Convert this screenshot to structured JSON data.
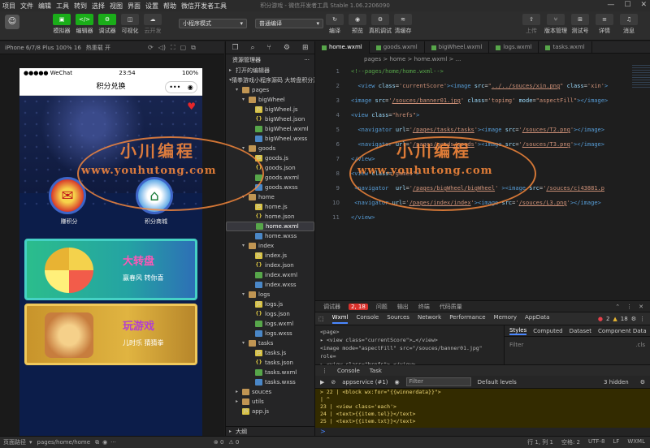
{
  "menubar": {
    "items": [
      "项目",
      "文件",
      "编辑",
      "工具",
      "转到",
      "选择",
      "视图",
      "界面",
      "设置",
      "帮助",
      "微信开发者工具"
    ],
    "title": "积分游戏 - 微信开发者工具 Stable 1.06.2206090"
  },
  "toolbar": {
    "left_buttons": [
      {
        "label": "模拟器",
        "glyph": "▣"
      },
      {
        "label": "编辑器",
        "glyph": "</>"
      },
      {
        "label": "调试器",
        "glyph": "⚙"
      },
      {
        "label": "可视化",
        "glyph": "◫"
      },
      {
        "label": "云开发",
        "glyph": "☁"
      }
    ],
    "mode_select": "小程序模式",
    "compile_select": "普通编译",
    "mid_buttons": [
      {
        "label": "编译",
        "glyph": "↻"
      },
      {
        "label": "预览",
        "glyph": "◉"
      },
      {
        "label": "真机调试",
        "glyph": "⚙"
      },
      {
        "label": "清缓存",
        "glyph": "≋"
      }
    ],
    "right_buttons": [
      {
        "label": "上传",
        "glyph": "⇧"
      },
      {
        "label": "版本管理",
        "glyph": "⑂"
      },
      {
        "label": "测试号",
        "glyph": "⊞"
      },
      {
        "label": "详情",
        "glyph": "≡"
      },
      {
        "label": "消息",
        "glyph": "♫"
      }
    ]
  },
  "simulator": {
    "device": "iPhone 6/7/8 Plus 100% 16",
    "hot_reload": "热重载 开",
    "status": {
      "carrier": "●●●●● WeChat",
      "time": "23:54",
      "battery": "100%"
    },
    "nav_title": "积分兑换",
    "icons": [
      {
        "label": "赚积分"
      },
      {
        "label": "积分商城"
      }
    ],
    "cards": [
      {
        "title": "大转盘",
        "subtitle": "赢春风  转你喜"
      },
      {
        "title": "玩游戏",
        "subtitle": "儿时乐  猜猜拳"
      }
    ]
  },
  "explorer": {
    "title": "资源管理器",
    "sections": {
      "open_editors": "打开的编辑器",
      "project": "猜拳游戏小程序源码 大转盘积分游..."
    },
    "tree": [
      {
        "name": "pages",
        "type": "folder",
        "depth": 1,
        "open": true
      },
      {
        "name": "bigWheel",
        "type": "folder",
        "depth": 2,
        "open": true
      },
      {
        "name": "bigWheel.js",
        "type": "js",
        "depth": 3
      },
      {
        "name": "bigWheel.json",
        "type": "json",
        "depth": 3
      },
      {
        "name": "bigWheel.wxml",
        "type": "wxml",
        "depth": 3
      },
      {
        "name": "bigWheel.wxss",
        "type": "wxss",
        "depth": 3
      },
      {
        "name": "goods",
        "type": "folder",
        "depth": 2,
        "open": true
      },
      {
        "name": "goods.js",
        "type": "js",
        "depth": 3
      },
      {
        "name": "goods.json",
        "type": "json",
        "depth": 3
      },
      {
        "name": "goods.wxml",
        "type": "wxml",
        "depth": 3
      },
      {
        "name": "goods.wxss",
        "type": "wxss",
        "depth": 3
      },
      {
        "name": "home",
        "type": "folder",
        "depth": 2,
        "open": true
      },
      {
        "name": "home.js",
        "type": "js",
        "depth": 3
      },
      {
        "name": "home.json",
        "type": "json",
        "depth": 3
      },
      {
        "name": "home.wxml",
        "type": "wxml",
        "depth": 3,
        "selected": true
      },
      {
        "name": "home.wxss",
        "type": "wxss",
        "depth": 3
      },
      {
        "name": "index",
        "type": "folder",
        "depth": 2,
        "open": true
      },
      {
        "name": "index.js",
        "type": "js",
        "depth": 3
      },
      {
        "name": "index.json",
        "type": "json",
        "depth": 3
      },
      {
        "name": "index.wxml",
        "type": "wxml",
        "depth": 3
      },
      {
        "name": "index.wxss",
        "type": "wxss",
        "depth": 3
      },
      {
        "name": "logs",
        "type": "folder",
        "depth": 2,
        "open": true
      },
      {
        "name": "logs.js",
        "type": "js",
        "depth": 3
      },
      {
        "name": "logs.json",
        "type": "json",
        "depth": 3
      },
      {
        "name": "logs.wxml",
        "type": "wxml",
        "depth": 3
      },
      {
        "name": "logs.wxss",
        "type": "wxss",
        "depth": 3
      },
      {
        "name": "tasks",
        "type": "folder",
        "depth": 2,
        "open": true
      },
      {
        "name": "tasks.js",
        "type": "js",
        "depth": 3
      },
      {
        "name": "tasks.json",
        "type": "json",
        "depth": 3
      },
      {
        "name": "tasks.wxml",
        "type": "wxml",
        "depth": 3
      },
      {
        "name": "tasks.wxss",
        "type": "wxss",
        "depth": 3
      },
      {
        "name": "souces",
        "type": "folder",
        "depth": 1,
        "open": false
      },
      {
        "name": "utils",
        "type": "folder",
        "depth": 1,
        "open": false
      },
      {
        "name": "app.js",
        "type": "js",
        "depth": 1
      }
    ],
    "outline": "大纲"
  },
  "editor": {
    "tabs": [
      "home.wxml",
      "goods.wxml",
      "bigWheel.wxml",
      "logs.wxml",
      "tasks.wxml"
    ],
    "breadcrumb": "pages > home > home.wxml > ...",
    "lines": [
      {
        "n": "1",
        "html": "<span class=\"cm\">&lt;!--pages/home/home.wxml--&gt;</span>"
      },
      {
        "n": "2",
        "html": "  <span class=\"tg\">&lt;view</span> <span class=\"at\">class</span>=<span class=\"st\">'currentScore'</span><span class=\"tg\">&gt;&lt;image</span> <span class=\"at\">src</span>=<span class=\"st\">\"<u>../../souces/xin.png</u>\"</span> <span class=\"at\">class</span>=<span class=\"st\">'xin'</span><span class=\"tg\">&gt;</span>"
      },
      {
        "n": "3",
        "html": "<span class=\"tg\">&lt;image</span> <span class=\"at\">src</span>=<span class=\"st\">'<u>/souces/banner01.jpg</u>'</span> <span class=\"at\">class</span>=<span class=\"st\">'topimg'</span> <span class=\"at\">mode</span>=<span class=\"st\">\"aspectFill\"</span><span class=\"tg\">&gt;&lt;/image&gt;</span>"
      },
      {
        "n": "4",
        "html": "<span class=\"tg\">&lt;view</span> <span class=\"at\">class</span>=<span class=\"st\">\"hrefs\"</span><span class=\"tg\">&gt;</span>"
      },
      {
        "n": "5",
        "html": "  <span class=\"tg\">&lt;navigator</span> <span class=\"at\">url</span>=<span class=\"st\">'<u>/pages/tasks/tasks</u>'</span><span class=\"tg\">&gt;&lt;image</span> <span class=\"at\">src</span>=<span class=\"st\">'<u>/souces/T2.png</u>'</span><span class=\"tg\">&gt;&lt;/image&gt;</span>"
      },
      {
        "n": "6",
        "html": "  <span class=\"tg\">&lt;navigator</span> <span class=\"at\">url</span>=<span class=\"st\">'<u>/pages/goods/goods</u>'</span><span class=\"tg\">&gt;&lt;image</span> <span class=\"at\">src</span>=<span class=\"st\">'<u>/souces/T3.png</u>'</span><span class=\"tg\">&gt;&lt;/image&gt;</span>"
      },
      {
        "n": "7",
        "html": "<span class=\"tg\">&lt;/view&gt;</span>"
      },
      {
        "n": "8",
        "html": "<span class=\"tg\">&lt;view</span> <span class=\"at\">class</span>=<span class=\"st\">\"games\"</span><span class=\"tg\">&gt;</span>"
      },
      {
        "n": "9",
        "html": " <span class=\"tg\">&lt;navigator</span>  <span class=\"at\">url</span>=<span class=\"st\">'<u>/pages/bigWheel/bigWheel</u>'</span> <span class=\"tg\">&gt;&lt;image</span> <span class=\"at\">src</span>=<span class=\"st\">'<u>/souces/cj43881.p</u></span>"
      },
      {
        "n": "10",
        "html": " <span class=\"tg\">&lt;navigator</span> <span class=\"at\">url</span>=<span class=\"st\">'<u>/pages/index/index</u>'</span><span class=\"tg\">&gt;&lt;image</span> <span class=\"at\">src</span>=<span class=\"st\">'<u>/souces/L3.png</u>'</span><span class=\"tg\">&gt;&lt;/image&gt;</span>"
      },
      {
        "n": "11",
        "html": "<span class=\"tg\">&lt;/view&gt;</span>"
      }
    ]
  },
  "watermark": {
    "line1": "小川编程",
    "line2": "www.youhutong.com"
  },
  "debugger": {
    "title": "调试器",
    "badge": "2, 18",
    "top_tabs": [
      "问题",
      "输出",
      "终端",
      "代码质量"
    ],
    "dev_tabs": [
      "Wxml",
      "Console",
      "Sources",
      "Network",
      "Performance",
      "Memory",
      "AppData"
    ],
    "errors": "2",
    "warnings": "18",
    "elements": [
      "<page>",
      "  ▸ <view class=\"currentScore\">…</view>",
      "    <image mode=\"aspectFill\" src=\"/souces/banner01.jpg\" role=",
      "  ▸ <view class=\"hrefs\">…</view>"
    ],
    "style_tabs": [
      "Styles",
      "Computed",
      "Dataset",
      "Component Data"
    ],
    "filter_label": "Filter",
    "cls_label": ".cls",
    "console_tabs": [
      "Console",
      "Task"
    ],
    "context": "appservice (#1)",
    "filter_placeholder": "Filter",
    "levels": "Default levels",
    "hidden": "3 hidden",
    "console_lines": [
      "> 22 |     <block wx:for=\"{{winnerdata}}\">",
      "     |     ^",
      "  23 |         <view class='each'>",
      "  24 |           <text>{{item.tel}}</text>",
      "  25 |           <text>{{item.txt}}</text>"
    ],
    "prompt": ">"
  },
  "statusbar": {
    "left": "页面路径",
    "path": "pages/home/home",
    "right": [
      "行 1, 列 1",
      "空格: 2",
      "UTF-8",
      "LF",
      "WXML"
    ]
  }
}
